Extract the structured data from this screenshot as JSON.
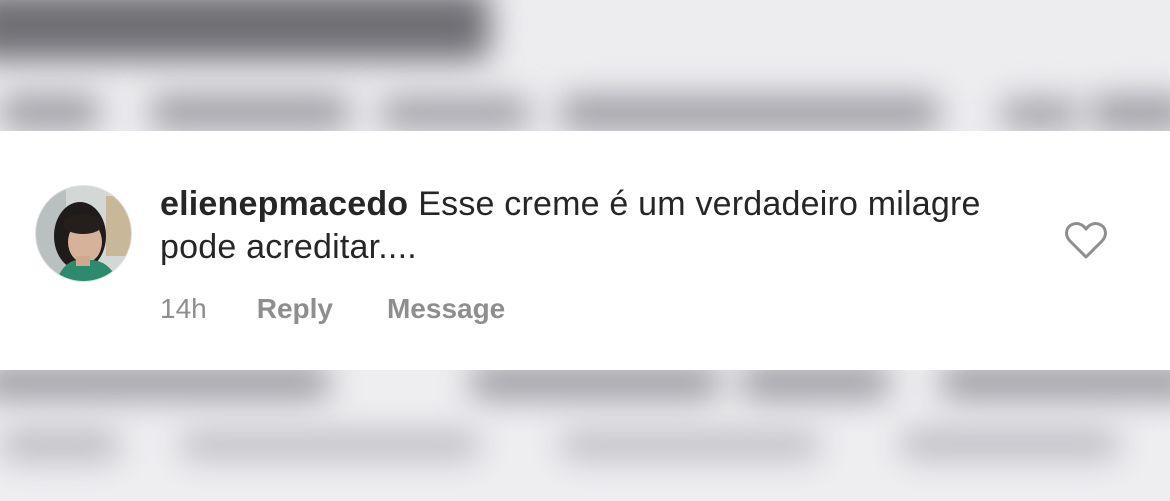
{
  "comment": {
    "username": "elienepmacedo",
    "text": "Esse creme é um verdadeiro milagre pode acreditar....",
    "time": "14h",
    "reply_label": "Reply",
    "message_label": "Message",
    "avatar_icon": "user-avatar-photo",
    "like_icon": "heart-outline-icon"
  },
  "colors": {
    "text": "#262626",
    "muted": "#8e8e8e",
    "card_background": "#ffffff",
    "dimmed_background": "#ececee"
  }
}
